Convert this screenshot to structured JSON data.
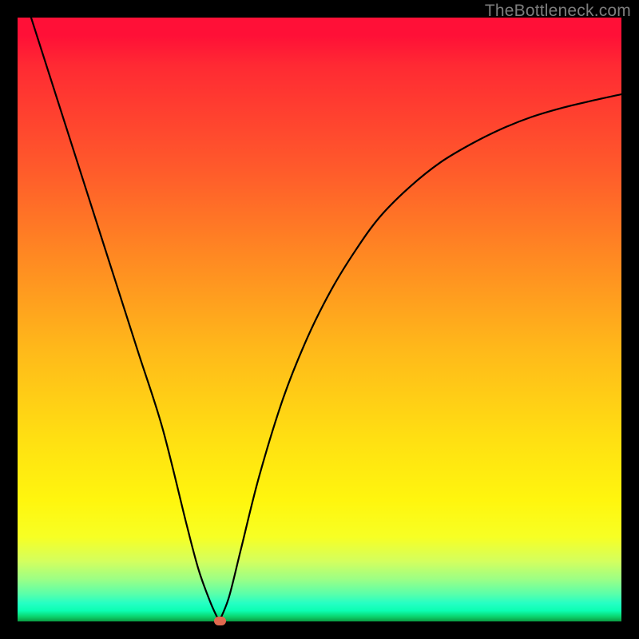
{
  "watermark": "TheBottleneck.com",
  "colors": {
    "frame": "#000000",
    "curve": "#000000",
    "dot": "#e0694f",
    "gradient_stops": [
      "#ff1037",
      "#ff2a33",
      "#ff5a2b",
      "#ff8a22",
      "#ffb91a",
      "#ffe012",
      "#fff60e",
      "#f7ff24",
      "#d4ff5e",
      "#9cff85",
      "#58ffab",
      "#25ffc4",
      "#0cffb3",
      "#0bd46e",
      "#0b9c42"
    ]
  },
  "chart_data": {
    "type": "line",
    "title": "",
    "xlabel": "",
    "ylabel": "",
    "xlim": [
      0,
      1
    ],
    "ylim": [
      0,
      1
    ],
    "legend": null,
    "notes": "V-shaped bottleneck curve. Minimum (optimal point) near x≈0.33, y≈0. Axes unlabeled; values are fractional positions.",
    "marker": {
      "x": 0.334,
      "y": 0.0
    },
    "series": [
      {
        "name": "bottleneck-curve",
        "x": [
          0.0,
          0.04,
          0.08,
          0.12,
          0.16,
          0.2,
          0.24,
          0.28,
          0.3,
          0.32,
          0.334,
          0.35,
          0.37,
          0.4,
          0.44,
          0.48,
          0.52,
          0.56,
          0.6,
          0.65,
          0.7,
          0.75,
          0.8,
          0.85,
          0.9,
          0.95,
          1.0
        ],
        "y": [
          1.07,
          0.945,
          0.82,
          0.695,
          0.57,
          0.445,
          0.32,
          0.16,
          0.085,
          0.03,
          0.0,
          0.04,
          0.12,
          0.24,
          0.37,
          0.47,
          0.55,
          0.615,
          0.67,
          0.72,
          0.76,
          0.79,
          0.815,
          0.835,
          0.85,
          0.862,
          0.873
        ]
      }
    ]
  }
}
